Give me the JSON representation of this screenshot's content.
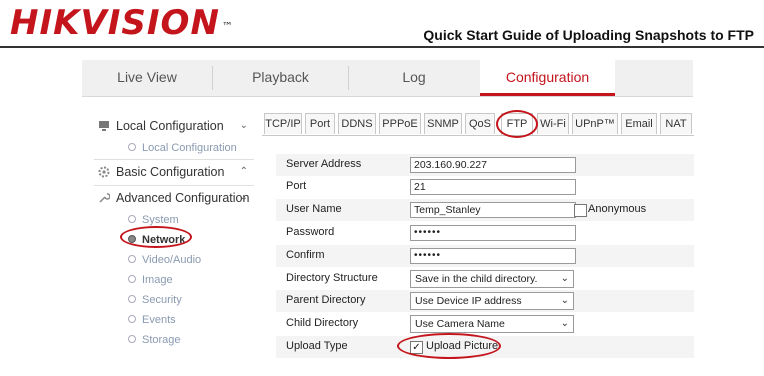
{
  "doc": {
    "brand": "HIKVISION",
    "brand_tm": "™",
    "title": "Quick Start Guide of Uploading Snapshots to FTP"
  },
  "nav": {
    "items": [
      {
        "label": "Live View",
        "active": false
      },
      {
        "label": "Playback",
        "active": false
      },
      {
        "label": "Log",
        "active": false
      },
      {
        "label": "Configuration",
        "active": true
      }
    ]
  },
  "sidebar": {
    "local": {
      "label": "Local Configuration",
      "icon": "monitor-icon",
      "chevron": "⌄"
    },
    "local_sub": "Local Configuration",
    "basic": {
      "label": "Basic Configuration",
      "icon": "gear-icon",
      "chevron": "⌃"
    },
    "advanced": {
      "label": "Advanced Configuration",
      "icon": "wrench-icon",
      "chevron": "⌄"
    },
    "advanced_items": [
      "System",
      "Network",
      "Video/Audio",
      "Image",
      "Security",
      "Events",
      "Storage"
    ],
    "active_item": "Network"
  },
  "tabs": [
    "TCP/IP",
    "Port",
    "DDNS",
    "PPPoE",
    "SNMP",
    "QoS",
    "FTP",
    "Wi-Fi",
    "UPnP™",
    "Email",
    "NAT"
  ],
  "active_tab": "FTP",
  "form": {
    "server_address": {
      "label": "Server Address",
      "value": "203.160.90.227"
    },
    "port": {
      "label": "Port",
      "value": "21"
    },
    "user_name": {
      "label": "User Name",
      "value": "Temp_Stanley"
    },
    "anonymous": {
      "label": "Anonymous",
      "checked": false
    },
    "password": {
      "label": "Password",
      "value": "••••••"
    },
    "confirm": {
      "label": "Confirm",
      "value": "••••••"
    },
    "directory_structure": {
      "label": "Directory Structure",
      "value": "Save in the child directory."
    },
    "parent_directory": {
      "label": "Parent Directory",
      "value": "Use Device IP address"
    },
    "child_directory": {
      "label": "Child Directory",
      "value": "Use Camera Name"
    },
    "upload_type": {
      "label": "Upload Type",
      "option_label": "Upload Picture",
      "checked": true,
      "check_glyph": "✓"
    }
  },
  "colors": {
    "brand_red": "#c4151c",
    "annotation_red": "#c4151c"
  }
}
